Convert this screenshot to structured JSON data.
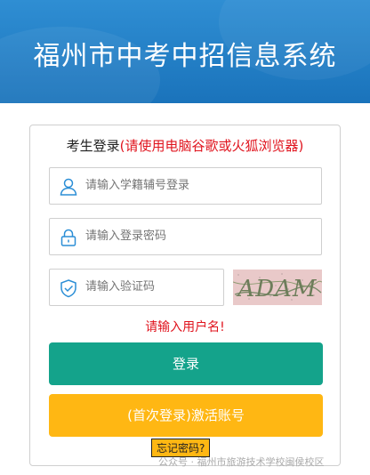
{
  "header": {
    "title": "福州市中考中招信息系统"
  },
  "login": {
    "title": "考生登录",
    "hint": "(请使用电脑谷歌或火狐浏览器)",
    "username_placeholder": "请输入学籍辅号登录",
    "password_placeholder": "请输入登录密码",
    "captcha_placeholder": "请输入验证码",
    "captcha_text": "ADAM",
    "error": "请输入用户名!",
    "login_button": "登录",
    "activate_button": "(首次登录)激活账号",
    "forgot_link": "忘记密码?"
  },
  "watermark": {
    "text": "公众号 · 福州市旅游技术学校闽侯校区"
  },
  "colors": {
    "header": "#1a73bb",
    "primary": "#14a38b",
    "secondary": "#ffb713",
    "error": "#e0141e"
  }
}
